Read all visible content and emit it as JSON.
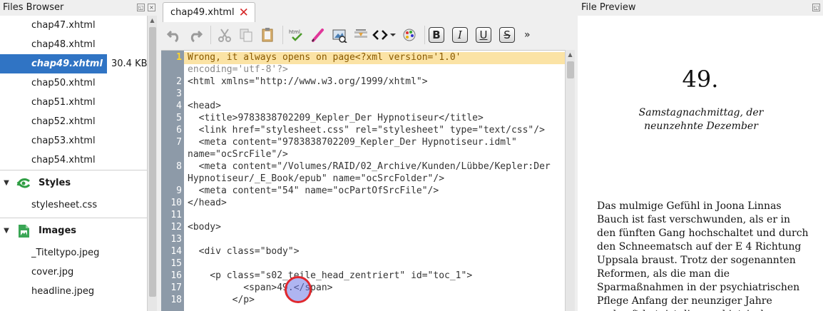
{
  "files_browser": {
    "title": "Files Browser",
    "files": [
      {
        "name": "chap47.xhtml"
      },
      {
        "name": "chap48.xhtml"
      },
      {
        "name": "chap49.xhtml",
        "size": "30.4 KB",
        "selected": true
      },
      {
        "name": "chap50.xhtml"
      },
      {
        "name": "chap51.xhtml"
      },
      {
        "name": "chap52.xhtml"
      },
      {
        "name": "chap53.xhtml"
      },
      {
        "name": "chap54.xhtml"
      }
    ],
    "styles_group": "Styles",
    "styles": [
      "stylesheet.css"
    ],
    "images_group": "Images",
    "images": [
      "_Titeltypo.jpeg",
      "cover.jpg",
      "headline.jpeg"
    ]
  },
  "editor": {
    "tab_label": "chap49.xhtml",
    "toolbar_icons": [
      "undo-icon",
      "redo-icon",
      "cut-icon",
      "copy-icon",
      "paste-icon",
      "html-check-icon",
      "pen-icon",
      "image-icon",
      "insert-icon",
      "code-tags-icon",
      "palette-icon"
    ],
    "format_buttons": [
      "B",
      "I",
      "U",
      "S"
    ],
    "more_label": "»",
    "line_numbers": [
      "1",
      "2",
      "3",
      "4",
      "5",
      "6",
      "7",
      "8",
      "9",
      "10",
      "11",
      "12",
      "13",
      "14",
      "15",
      "16",
      "17",
      "18"
    ],
    "code_lines": [
      "Wrong, it always opens on page<?xml version='1.0'",
      "encoding='utf-8'?>",
      "<html xmlns=\"http://www.w3.org/1999/xhtml\">",
      "",
      "<head>",
      "  <title>9783838702209_Kepler_Der Hypnotiseur</title>",
      "  <link href=\"stylesheet.css\" rel=\"stylesheet\" type=\"text/css\"/>",
      "  <meta content=\"9783838702209_Kepler_Der Hypnotiseur.idml\"",
      "name=\"ocSrcFile\"/>",
      "  <meta content=\"/Volumes/RAID/02_Archive/Kunden/Lübbe/Kepler:Der",
      "Hypnotiseur/_E_Book/epub\" name=\"ocSrcFolder\"/>",
      "  <meta content=\"54\" name=\"ocPartOfSrcFile\"/>",
      "</head>",
      "",
      "<body>",
      "",
      "  <div class=\"body\">",
      "",
      "    <p class=\"s02_teile_head_zentriert\" id=\"toc_1\">",
      "          <span>49.</span>",
      "        </p>"
    ]
  },
  "preview": {
    "title": "File Preview",
    "chapter_number": "49.",
    "subtitle": "Samstagnachmittag, der neunzehnte Dezember",
    "body_text": "Das mulmige Gefühl in Joona Linnas Bauch ist fast verschwunden, als er in den fünften Gang hochschaltet und durch den Schneematsch auf der E 4 Richtung Uppsala braust. Trotz der sogenannten Reformen, als die man die Sparmaßnahmen in der psychiatrischen Pflege Anfang der neunziger Jahre verkauft hat, ist die psychiatrische"
  },
  "colors": {
    "selection": "#3074c4",
    "current_line": "#fbe3a5",
    "gutter": "#8d9aa8",
    "marker_ring": "#e0282e",
    "close_x": "#d62828"
  }
}
